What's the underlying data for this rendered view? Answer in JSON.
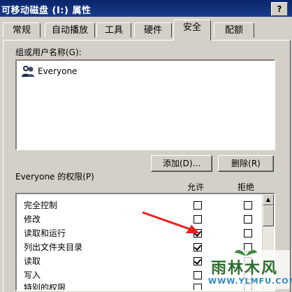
{
  "window": {
    "title": "可移动磁盘 (I:) 属性",
    "help_label": "?"
  },
  "tabs": [
    {
      "label": "常规"
    },
    {
      "label": "自动播放"
    },
    {
      "label": "工具"
    },
    {
      "label": "硬件"
    },
    {
      "label": "安全",
      "active": true
    },
    {
      "label": "配额"
    }
  ],
  "groups": {
    "label": "组或用户名称(G):",
    "users": [
      {
        "name": "Everyone",
        "icon": "users-group-icon"
      }
    ]
  },
  "buttons": {
    "add": "添加(D)...",
    "remove": "删除(R)"
  },
  "permissions": {
    "header": "Everyone 的权限(P)",
    "allow_label": "允许",
    "deny_label": "拒绝",
    "rows": [
      {
        "name": "完全控制",
        "allow": false,
        "deny": false
      },
      {
        "name": "修改",
        "allow": false,
        "deny": false
      },
      {
        "name": "读取和运行",
        "allow": true,
        "deny": false
      },
      {
        "name": "列出文件夹目录",
        "allow": true,
        "deny": false
      },
      {
        "name": "读取",
        "allow": true,
        "deny": false
      },
      {
        "name": "写入",
        "allow": false,
        "deny": false
      },
      {
        "name": "特别的权限",
        "allow": false,
        "deny": false
      }
    ]
  },
  "watermark": {
    "brand": "雨林木风",
    "url": "WWW.YLMFU.COM"
  },
  "colors": {
    "title_bar": "#0a246a",
    "dialog_bg": "#d4d0c8",
    "annotation_arrow": "#e82020",
    "watermark_green": "#2d6e2d"
  }
}
